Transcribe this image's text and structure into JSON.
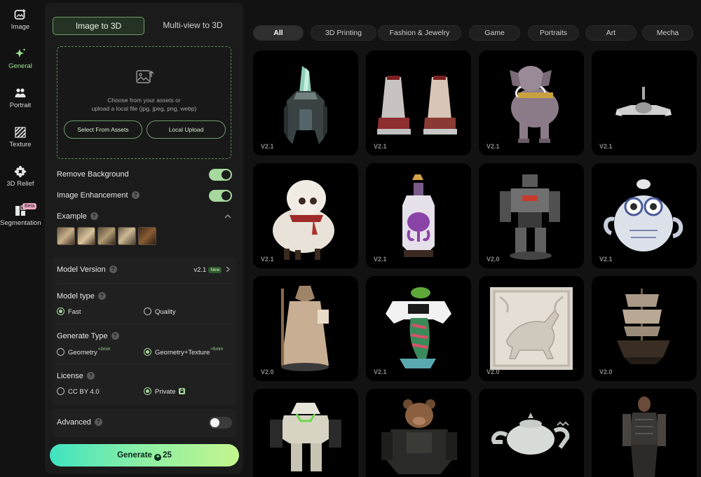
{
  "rail": {
    "items": [
      {
        "label": "Image",
        "icon": "image-sparkle-icon"
      },
      {
        "label": "General",
        "icon": "sparkle-icon"
      },
      {
        "label": "Portrait",
        "icon": "people-icon"
      },
      {
        "label": "Texture",
        "icon": "texture-hatch-icon"
      },
      {
        "label": "3D Relief",
        "icon": "relief-flower-icon"
      },
      {
        "label": "Segmentation",
        "icon": "segmentation-icon",
        "badge": "Beta"
      }
    ],
    "active": "General"
  },
  "mode_tabs": {
    "active": "Image to 3D",
    "inactive": "Multi-view to 3D"
  },
  "upload": {
    "line1": "Choose from your assets or",
    "line2": "upload a local file (jpg, jpeg, png, webp)",
    "select_assets": "Select From Assets",
    "local_upload": "Local Upload"
  },
  "options": {
    "remove_background": {
      "label": "Remove Background",
      "enabled": true
    },
    "image_enhancement": {
      "label": "Image Enhancement",
      "enabled": true
    },
    "example_label": "Example"
  },
  "settings": {
    "model_version": {
      "label": "Model Version",
      "value": "v2.1",
      "badge": "New"
    },
    "model_type": {
      "label": "Model type",
      "options": [
        "Fast",
        "Quality"
      ],
      "selected": "Fast"
    },
    "generate_type": {
      "label": "Generate Type",
      "options": [
        {
          "label": "Geometry",
          "eta": "≈2min"
        },
        {
          "label": "Geometry+Texture",
          "eta": "≈5min"
        }
      ],
      "selected": "Geometry+Texture"
    },
    "license": {
      "label": "License",
      "options": [
        "CC BY 4.0",
        "Private"
      ],
      "selected": "Private"
    },
    "advanced": {
      "label": "Advanced",
      "enabled": false
    }
  },
  "generate": {
    "label": "Generate",
    "cost": "25"
  },
  "categories": [
    "All",
    "3D Printing",
    "Fashion & Jewelry",
    "Game",
    "Portraits",
    "Art",
    "Mecha"
  ],
  "active_category": "All",
  "gallery": [
    {
      "subject": "crystal-ship",
      "version": "V2.1"
    },
    {
      "subject": "platform-shoes",
      "version": "V2.1"
    },
    {
      "subject": "ornate-elephant",
      "version": "V2.1"
    },
    {
      "subject": "drone-craft",
      "version": "V2.1"
    },
    {
      "subject": "scarf-sheep",
      "version": "V2.1"
    },
    {
      "subject": "octopus-bottle",
      "version": "V2.1"
    },
    {
      "subject": "battle-mech",
      "version": "V2.0"
    },
    {
      "subject": "owl-teapot",
      "version": "V2.1"
    },
    {
      "subject": "robed-monk",
      "version": "V2.0"
    },
    {
      "subject": "controller-frog",
      "version": "V2.1"
    },
    {
      "subject": "horse-relief",
      "version": "V2.0"
    },
    {
      "subject": "sailing-ship",
      "version": "V2.0"
    },
    {
      "subject": "white-mech",
      "version": ""
    },
    {
      "subject": "armored-bear",
      "version": ""
    },
    {
      "subject": "dragon-teapot",
      "version": ""
    },
    {
      "subject": "armored-knight",
      "version": ""
    }
  ],
  "colors": {
    "accent": "#a7d89e",
    "panel": "#1b1b1b",
    "background": "#121212",
    "card": "#000000"
  }
}
